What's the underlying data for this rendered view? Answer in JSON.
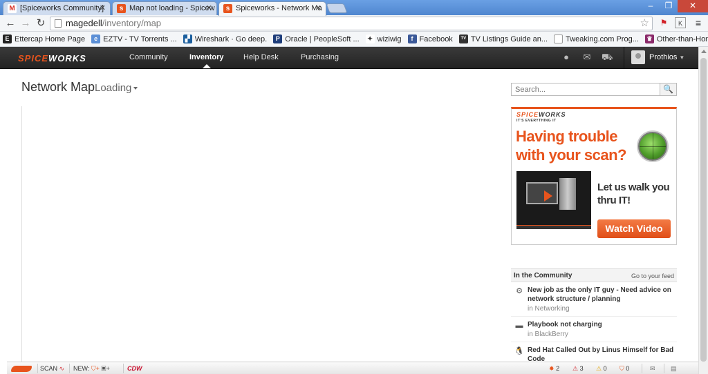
{
  "browser": {
    "tabs": [
      {
        "title": "[Spiceworks Community]",
        "favicon": "gmail-icon"
      },
      {
        "title": "Map not loading - Spicew",
        "favicon": "spiceworks-icon"
      },
      {
        "title": "Spiceworks - Network Ma",
        "favicon": "spiceworks-icon",
        "active": true
      }
    ],
    "url_host": "magedell",
    "url_path": "/inventory/map",
    "bookmarks": [
      {
        "label": "Ettercap Home Page",
        "icon": "ettercap-icon"
      },
      {
        "label": "EZTV - TV Torrents ...",
        "icon": "eztv-icon"
      },
      {
        "label": "Wireshark · Go deep.",
        "icon": "wireshark-icon"
      },
      {
        "label": "Oracle | PeopleSoft ...",
        "icon": "oracle-icon"
      },
      {
        "label": "wiziwig",
        "icon": "wiziwig-icon"
      },
      {
        "label": "Facebook",
        "icon": "facebook-icon"
      },
      {
        "label": "TV Listings Guide an...",
        "icon": "tv-listings-icon"
      },
      {
        "label": "Tweaking.com Prog...",
        "icon": "page-icon"
      },
      {
        "label": "Other-than-Honora...",
        "icon": "other-icon"
      }
    ]
  },
  "app": {
    "logo": "SPICEWORKS",
    "logo_parts": [
      "SPICE",
      "WORKS"
    ],
    "nav": [
      "Community",
      "Inventory",
      "Help Desk",
      "Purchasing"
    ],
    "active_nav": "Inventory",
    "username": "Prothios",
    "colors": {
      "brand": "#e8541d",
      "header": "#2b2b2b"
    }
  },
  "page": {
    "title": "Network Map",
    "status": "Loading",
    "search_placeholder": "Search..."
  },
  "ad": {
    "logo": "SPICEWORKS",
    "logo_parts": [
      "SPICE",
      "WORKS"
    ],
    "tagline": "IT'S EVERYTHING IT",
    "headline": "Having trouble with your scan?",
    "subline": "Let us walk you thru IT!",
    "button": "Watch Video"
  },
  "community": {
    "heading": "In the Community",
    "feed_link": "Go to your feed",
    "items": [
      {
        "title": "New job as the only IT guy - Need advice on network structure / planning",
        "sub": "in Networking",
        "icon": "network-icon"
      },
      {
        "title": "Playbook not charging",
        "sub": "in BlackBerry",
        "icon": "blackberry-icon"
      },
      {
        "title": "Red Hat Called Out by Linus Himself for Bad Code",
        "sub": "",
        "icon": "linux-penguin-icon"
      }
    ]
  },
  "bottombar": {
    "scan": "SCAN",
    "new": "NEW:",
    "cdw": "CDW",
    "counts": {
      "spice": "2",
      "alerts": "3",
      "warnings": "0",
      "shield": "0"
    }
  }
}
